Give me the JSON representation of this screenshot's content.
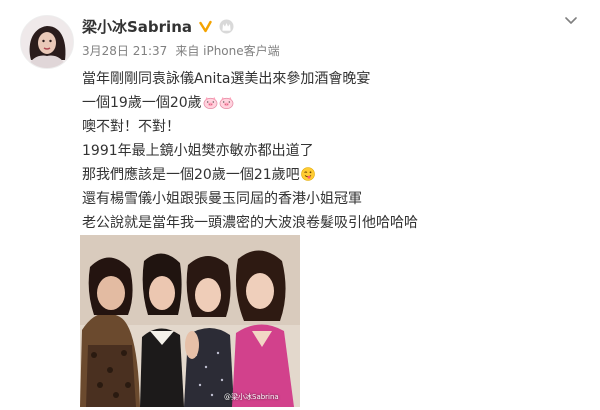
{
  "post": {
    "username": "梁小冰Sabrina",
    "verified_icon": "verified-v-icon",
    "membership_icon": "crown-badge-icon",
    "timestamp": "3月28日 21:37",
    "source": "来自 iPhone客户端",
    "lines": [
      "當年剛剛同袁詠儀Anita選美出來參加酒會晚宴",
      "一個19歲一個20歲",
      "噢不對！不對！",
      "1991年最上鏡小姐樊亦敏亦都出道了",
      "那我們應該是一個20歲一個21歲吧",
      "還有楊雪儀小姐跟張曼玉同屆的香港小姐冠軍",
      "老公說就是當年我一頭濃密的大波浪卷髮吸引他哈哈哈"
    ],
    "emojis": {
      "line2": "pig-face-emoji",
      "line5": "wink-tongue-emoji"
    },
    "photo_watermark": "@梁小冰Sabrina"
  },
  "colors": {
    "text": "#333333",
    "meta": "#808080",
    "verified": "#f4a300"
  }
}
